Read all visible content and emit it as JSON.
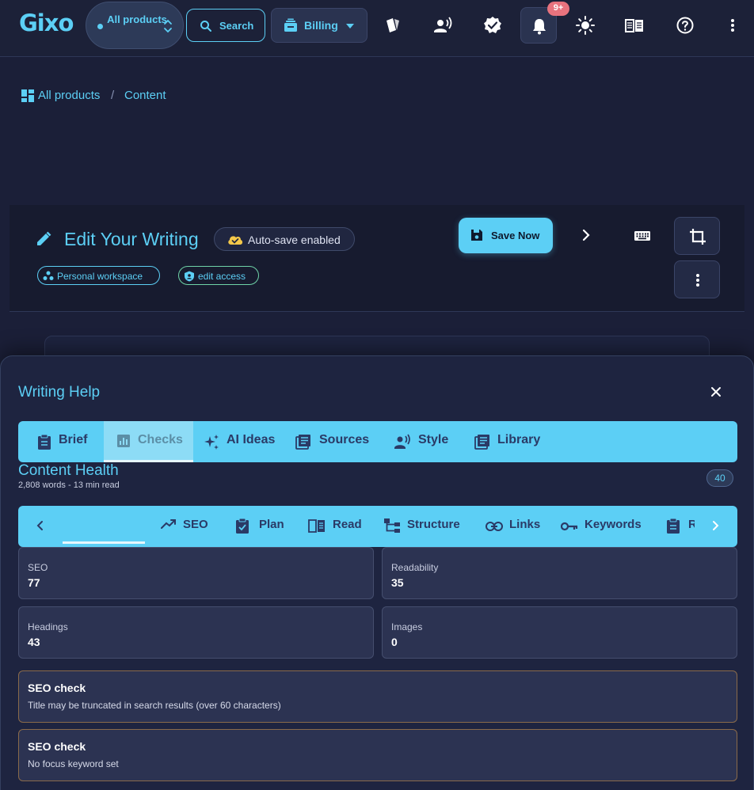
{
  "topbar": {
    "logo": "Gixo",
    "product_switch": "All products",
    "search_label": "Search",
    "billing_label": "Billing",
    "notif_badge": "9+"
  },
  "breadcrumb": {
    "items": [
      "All products",
      "Content"
    ],
    "separator": "/"
  },
  "editor": {
    "title": "Edit Your Writing",
    "autosave": "Auto-save enabled",
    "workspace_chip": "Personal workspace",
    "access_chip": "edit access",
    "save_label": "Save Now"
  },
  "panel": {
    "title": "Writing Help",
    "tabs": [
      {
        "label": "Brief",
        "icon": "clipboard-icon"
      },
      {
        "label": "Checks",
        "icon": "chart-icon",
        "active": true
      },
      {
        "label": "AI Ideas",
        "icon": "sparkle-icon"
      },
      {
        "label": "Sources",
        "icon": "list-icon"
      },
      {
        "label": "Style",
        "icon": "voice-icon"
      },
      {
        "label": "Library",
        "icon": "library-icon"
      }
    ],
    "health": {
      "title": "Content Health",
      "subtitle": "2,808 words - 13 min read",
      "score": "40"
    },
    "subtabs": [
      {
        "label": "SEO",
        "icon": "trend-icon"
      },
      {
        "label": "Plan",
        "icon": "check-clipboard-icon"
      },
      {
        "label": "Read",
        "icon": "book-icon"
      },
      {
        "label": "Structure",
        "icon": "tree-icon"
      },
      {
        "label": "Links",
        "icon": "link-icon"
      },
      {
        "label": "Keywords",
        "icon": "key-icon"
      },
      {
        "label": "R",
        "icon": "clipboard-icon"
      }
    ],
    "stats": [
      {
        "label": "SEO",
        "value": "77"
      },
      {
        "label": "Readability",
        "value": "35"
      },
      {
        "label": "Headings",
        "value": "43"
      },
      {
        "label": "Images",
        "value": "0"
      }
    ],
    "checks": [
      {
        "title": "SEO check",
        "detail": "Title may be truncated in search results (over 60 characters)"
      },
      {
        "title": "SEO check",
        "detail": "No focus keyword set"
      }
    ]
  },
  "colors": {
    "accent": "#5ccff5",
    "background": "#1b1f38",
    "warning_border": "#8a6a4a",
    "badge": "#e8737e"
  }
}
